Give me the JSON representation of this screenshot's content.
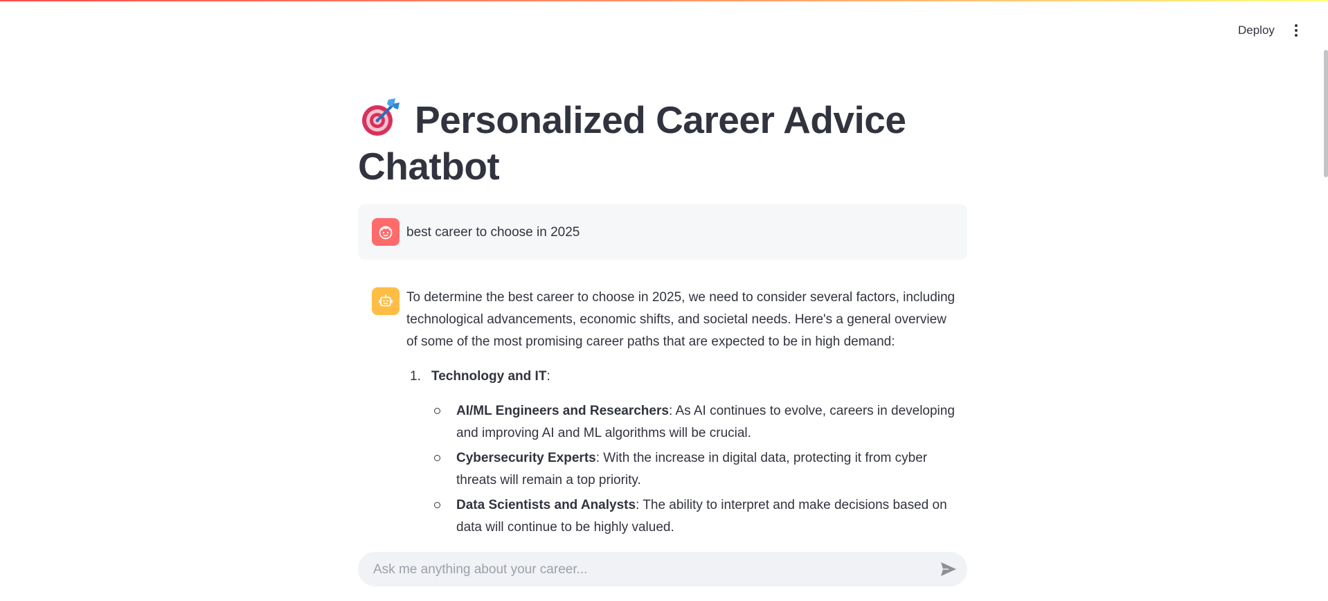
{
  "header": {
    "deploy_label": "Deploy",
    "menu_icon": "kebab-menu-icon"
  },
  "page": {
    "title_emoji": "target-dart-icon",
    "title": "Personalized Career Advice Chatbot"
  },
  "messages": {
    "user": {
      "avatar_icon": "user-face-icon",
      "text": "best career to choose in 2025"
    },
    "assistant": {
      "avatar_icon": "robot-icon",
      "intro": "To determine the best career to choose in 2025, we need to consider several factors, including technological advancements, economic shifts, and societal needs. Here's a general overview of some of the most promising career paths that are expected to be in high demand:",
      "sections": [
        {
          "number": "1.",
          "heading": "Technology and IT",
          "heading_suffix": ":",
          "items": [
            {
              "title": "AI/ML Engineers and Researchers",
              "text": ": As AI continues to evolve, careers in developing and improving AI and ML algorithms will be crucial."
            },
            {
              "title": "Cybersecurity Experts",
              "text": ": With the increase in digital data, protecting it from cyber threats will remain a top priority."
            },
            {
              "title": "Data Scientists and Analysts",
              "text": ": The ability to interpret and make decisions based on data will continue to be highly valued."
            }
          ]
        }
      ]
    }
  },
  "chat_input": {
    "placeholder": "Ask me anything about your career...",
    "value": "",
    "send_icon": "send-icon"
  },
  "colors": {
    "user_avatar_bg": "#ff6b6b",
    "bot_avatar_bg": "#ffbd45",
    "text": "#31333f",
    "user_bubble_bg": "#f6f7f9",
    "input_bg": "#f0f2f6"
  }
}
